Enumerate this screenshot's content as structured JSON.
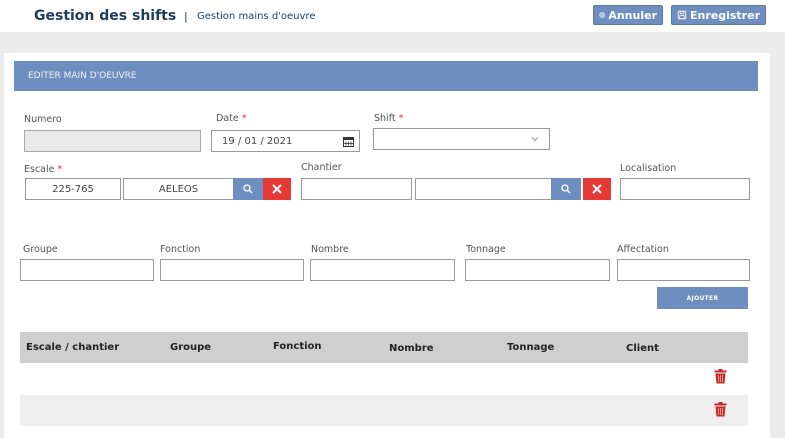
{
  "header": {
    "app_title": "Gestion des shifts",
    "separator": "|",
    "subtitle": "Gestion mains d'oeuvre",
    "cancel_label": "Annuler",
    "save_label": "Enregistrer"
  },
  "form": {
    "section_title": "EDITER MAIN D'OEUVRE",
    "numero": {
      "label": "Numero",
      "value": ""
    },
    "date": {
      "label": "Date",
      "required": "*",
      "value": "19 / 01 / 2021"
    },
    "shift": {
      "label": "Shift",
      "required": "*",
      "value": ""
    },
    "escale": {
      "label": "Escale",
      "required": "*",
      "code": "225-765",
      "name": "AELEOS"
    },
    "chantier": {
      "label": "Chantier",
      "code": "",
      "name": ""
    },
    "localisation": {
      "label": "Localisation",
      "value": ""
    },
    "groupe": {
      "label": "Groupe",
      "value": ""
    },
    "fonction": {
      "label": "Fonction",
      "value": ""
    },
    "nombre": {
      "label": "Nombre",
      "value": ""
    },
    "tonnage": {
      "label": "Tonnage",
      "value": ""
    },
    "affectation": {
      "label": "Affectation",
      "value": ""
    },
    "add_label": "AJOUTER"
  },
  "table": {
    "columns": [
      "Escale / chantier",
      "Groupe",
      "Fonction",
      "Nombre",
      "Tonnage",
      "Client"
    ],
    "rows": [
      {
        "escale_chantier": "",
        "groupe": "",
        "fonction": "",
        "nombre": "",
        "tonnage": "",
        "client": ""
      },
      {
        "escale_chantier": "",
        "groupe": "",
        "fonction": "",
        "nombre": "",
        "tonnage": "",
        "client": ""
      }
    ]
  },
  "colors": {
    "accent": "#6e8ebf",
    "title": "#1d3c5e",
    "danger": "#e53935",
    "trash": "#c62828"
  },
  "icons": [
    "cancel-icon",
    "save-icon",
    "calendar-icon",
    "chevron-down-icon",
    "search-icon",
    "close-icon",
    "trash-icon"
  ]
}
